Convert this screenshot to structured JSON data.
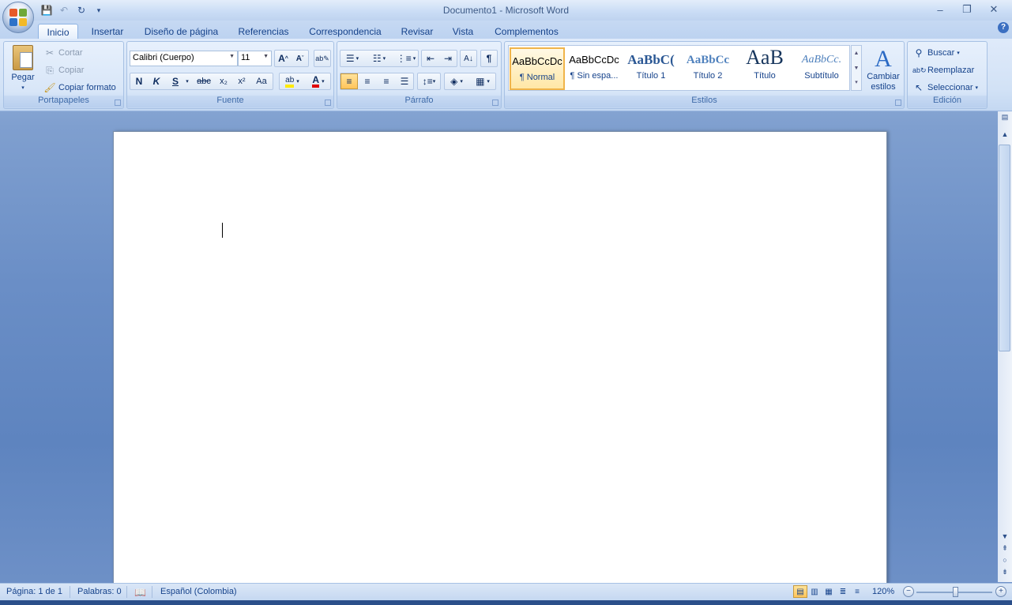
{
  "window": {
    "title": "Documento1 - Microsoft Word"
  },
  "tabs": [
    "Inicio",
    "Insertar",
    "Diseño de página",
    "Referencias",
    "Correspondencia",
    "Revisar",
    "Vista",
    "Complementos"
  ],
  "clipboard": {
    "paste": "Pegar",
    "cut": "Cortar",
    "copy": "Copiar",
    "format_painter": "Copiar formato",
    "label": "Portapapeles"
  },
  "font": {
    "name": "Calibri (Cuerpo)",
    "size": "11",
    "label": "Fuente",
    "bold": "N",
    "italic": "K",
    "underline": "S",
    "strike": "abc",
    "sub": "x₂",
    "sup": "x²",
    "case": "Aa"
  },
  "paragraph": {
    "label": "Párrafo"
  },
  "styles": {
    "label": "Estilos",
    "items": [
      {
        "preview": "AaBbCcDc",
        "name": "¶ Normal"
      },
      {
        "preview": "AaBbCcDc",
        "name": "¶ Sin espa..."
      },
      {
        "preview": "AaBbC(",
        "name": "Título 1"
      },
      {
        "preview": "AaBbCc",
        "name": "Título 2"
      },
      {
        "preview": "AaB",
        "name": "Título"
      },
      {
        "preview": "AaBbCc.",
        "name": "Subtítulo"
      }
    ],
    "change": "Cambiar estilos"
  },
  "editing": {
    "find": "Buscar",
    "replace": "Reemplazar",
    "select": "Seleccionar",
    "label": "Edición"
  },
  "status": {
    "page": "Página: 1 de 1",
    "words": "Palabras: 0",
    "language": "Español (Colombia)",
    "zoom": "120%"
  },
  "colors": {
    "accent": "#15428b",
    "selected": "#ffc45a"
  }
}
